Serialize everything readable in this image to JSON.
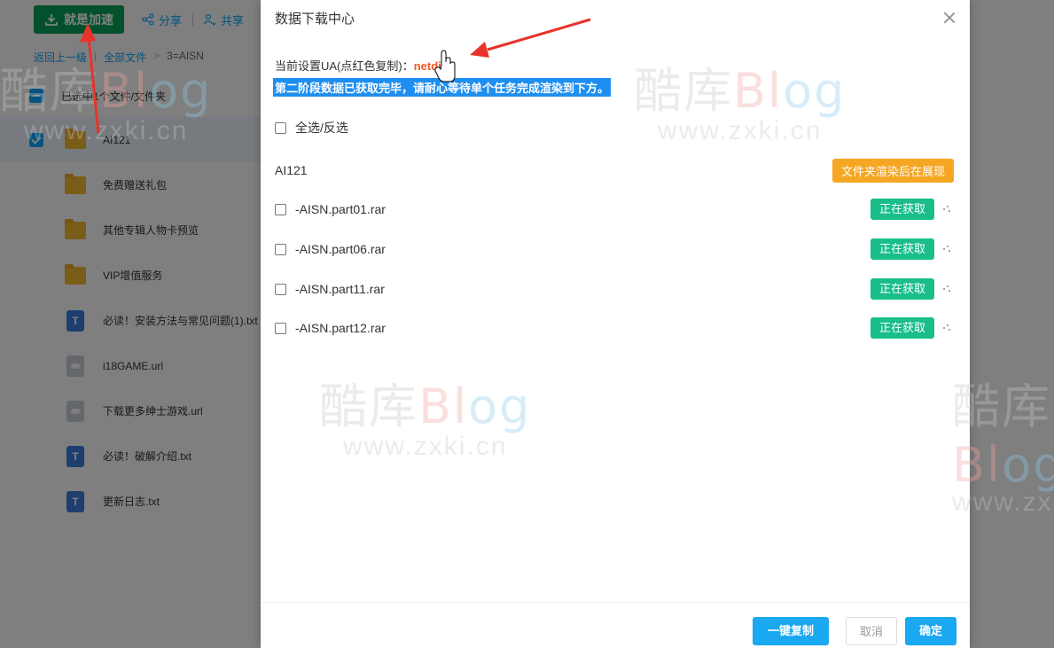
{
  "background": {
    "toolbar": {
      "accelerate_label": "就是加速",
      "share_label": "分享",
      "shared_label": "共享"
    },
    "breadcrumb": {
      "back": "返回上一级",
      "all_files": "全部文件",
      "separator": ">",
      "current": "3=AISN"
    },
    "selection_text": "已选中1个文件/文件夹",
    "files": [
      {
        "name": "AI121",
        "type": "folder",
        "selected": true
      },
      {
        "name": "免费赠送礼包",
        "type": "folder"
      },
      {
        "name": "其他专辑人物卡预览",
        "type": "folder"
      },
      {
        "name": "VIP增值服务",
        "type": "folder"
      },
      {
        "name": "必读！安装方法与常见问题(1).txt",
        "type": "txt"
      },
      {
        "name": "i18GAME.url",
        "type": "url"
      },
      {
        "name": "下载更多绅士游戏.url",
        "type": "url"
      },
      {
        "name": "必读！破解介绍.txt",
        "type": "txt"
      },
      {
        "name": "更新日志.txt",
        "type": "txt"
      }
    ]
  },
  "watermarks": [
    {
      "top": "酷库Blog",
      "bottom": "www.zxki.cn"
    },
    {
      "top": "酷库Blog",
      "bottom": "www.zxki.cn"
    },
    {
      "top": "酷库Blog",
      "bottom": "www.zxki.cn"
    },
    {
      "top": "酷库Blog",
      "bottom": "www.zxki.cn"
    }
  ],
  "modal": {
    "title": "数据下载中心",
    "ua_prefix": "当前设置UA(点红色复制)：",
    "ua_value": "netdisk",
    "status": "第二阶段数据已获取完毕，请耐心等待单个任务完成渲染到下方。",
    "select_all": "全选/反选",
    "folder_name": "AI121",
    "folder_badge": "文件夹渲染后在展现",
    "items": [
      {
        "name": "-AISN.part01.rar",
        "status": "正在获取"
      },
      {
        "name": "-AISN.part06.rar",
        "status": "正在获取"
      },
      {
        "name": "-AISN.part11.rar",
        "status": "正在获取"
      },
      {
        "name": "-AISN.part12.rar",
        "status": "正在获取"
      }
    ],
    "footer": {
      "copy_all": "一键复制",
      "cancel": "取消",
      "ok": "确定"
    }
  },
  "colors": {
    "accent": "#1aa8f0",
    "green": "#19be8a",
    "orange": "#f5a623",
    "ua_red": "#f05a23",
    "annotation_red": "#e8332a"
  }
}
